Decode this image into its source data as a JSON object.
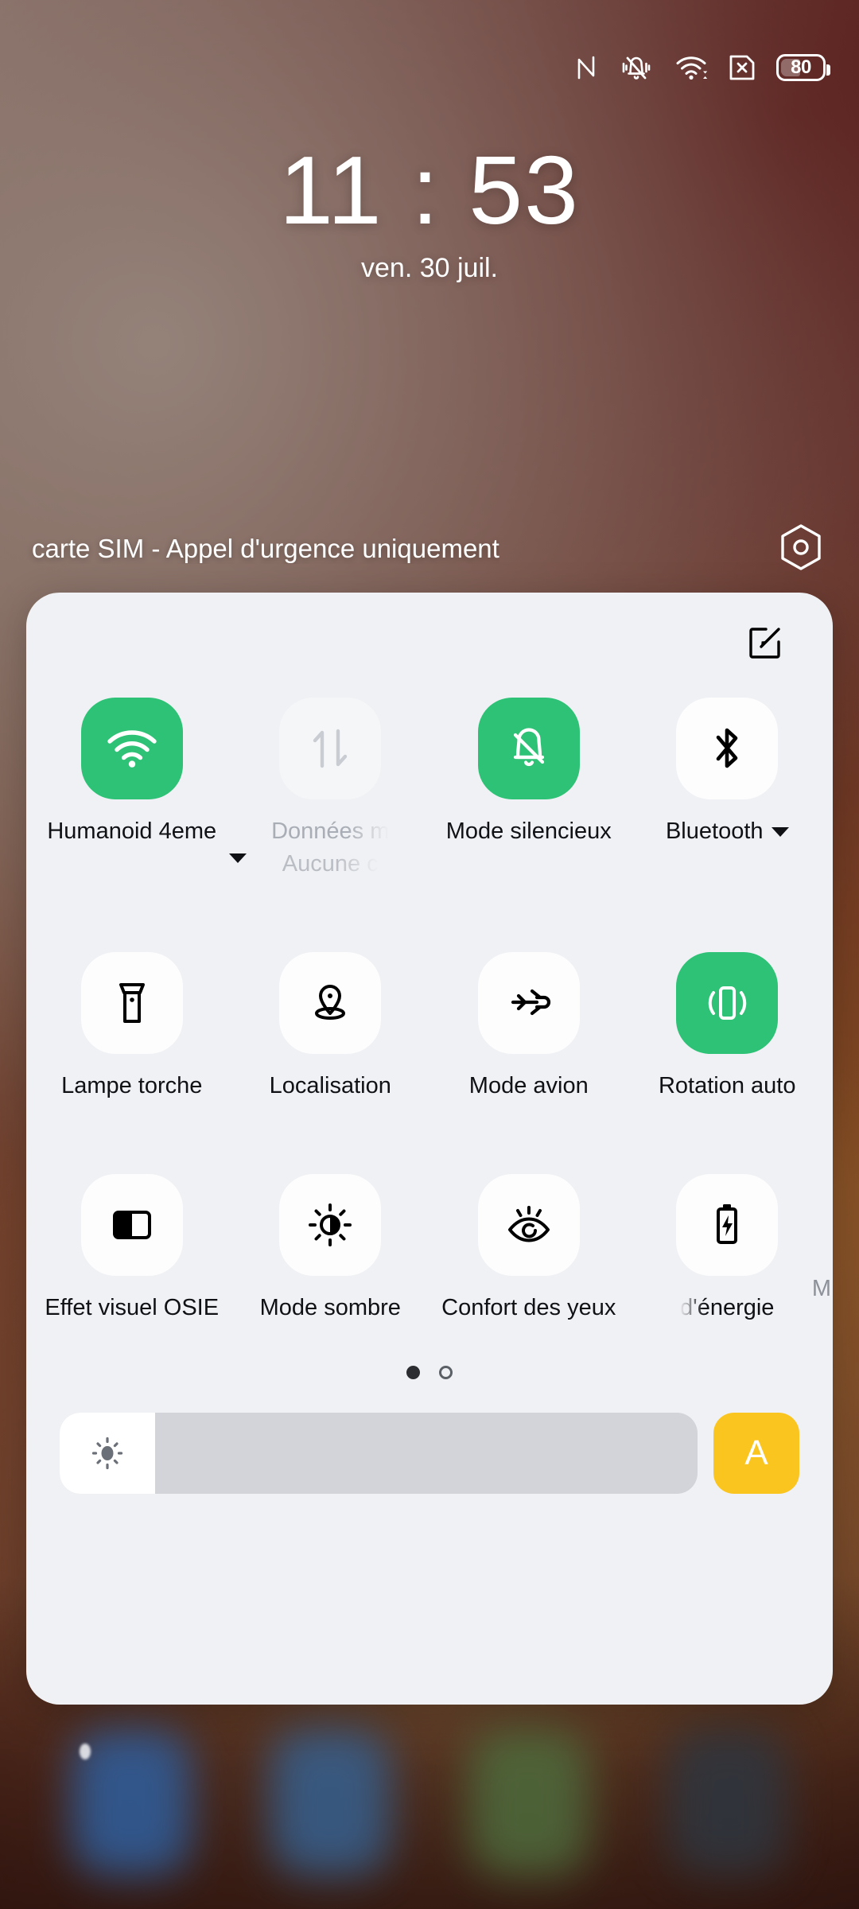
{
  "statusbar": {
    "icons": [
      "nfc-icon",
      "silent-vibrate-icon",
      "wifi-icon",
      "sim-missing-icon"
    ],
    "battery_percent": "80"
  },
  "lockscreen": {
    "time": "11 : 53",
    "date": "ven. 30 juil.",
    "carrier": "carte SIM - Appel d'urgence uniquement",
    "settings_icon": "settings-hex-icon"
  },
  "quick_settings": {
    "edit_icon": "edit-pencil-icon",
    "tiles": [
      {
        "icon": "wifi-icon",
        "label": "Humanoid 4eme",
        "state": "on",
        "has_caret": true
      },
      {
        "icon": "mobile-data-icon",
        "label": "Données m",
        "sublabel": "Aucune c",
        "state": "disabled",
        "has_caret": false
      },
      {
        "icon": "bell-off-icon",
        "label": "Mode silencieux",
        "state": "on",
        "has_caret": false
      },
      {
        "icon": "bluetooth-icon",
        "label": "Bluetooth",
        "state": "off",
        "has_caret": true
      },
      {
        "icon": "flashlight-icon",
        "label": "Lampe torche",
        "state": "off",
        "has_caret": false
      },
      {
        "icon": "location-pin-icon",
        "label": "Localisation",
        "state": "off",
        "has_caret": false
      },
      {
        "icon": "airplane-icon",
        "label": "Mode avion",
        "state": "off",
        "has_caret": false
      },
      {
        "icon": "rotate-phone-icon",
        "label": "Rotation auto",
        "state": "on",
        "has_caret": false
      },
      {
        "icon": "split-square-icon",
        "label": "Effet visuel OSIE",
        "state": "off",
        "has_caret": false
      },
      {
        "icon": "dark-mode-icon",
        "label": "Mode sombre",
        "state": "off",
        "has_caret": false
      },
      {
        "icon": "eye-comfort-icon",
        "label": "Confort des yeux",
        "state": "off",
        "has_caret": false
      },
      {
        "icon": "battery-saver-icon",
        "label": "d'énergie",
        "state": "off",
        "has_caret": false
      }
    ],
    "peek_label": "M",
    "pages": {
      "count": 2,
      "active": 1
    },
    "brightness": {
      "icon": "brightness-sun-icon",
      "value_percent": 15,
      "auto_label": "A"
    }
  },
  "colors": {
    "accent_on": "#2dc275",
    "auto_button": "#fbc520",
    "panel_bg": "#f0f1f4",
    "tile_off_bg": "#fdfdfe"
  }
}
